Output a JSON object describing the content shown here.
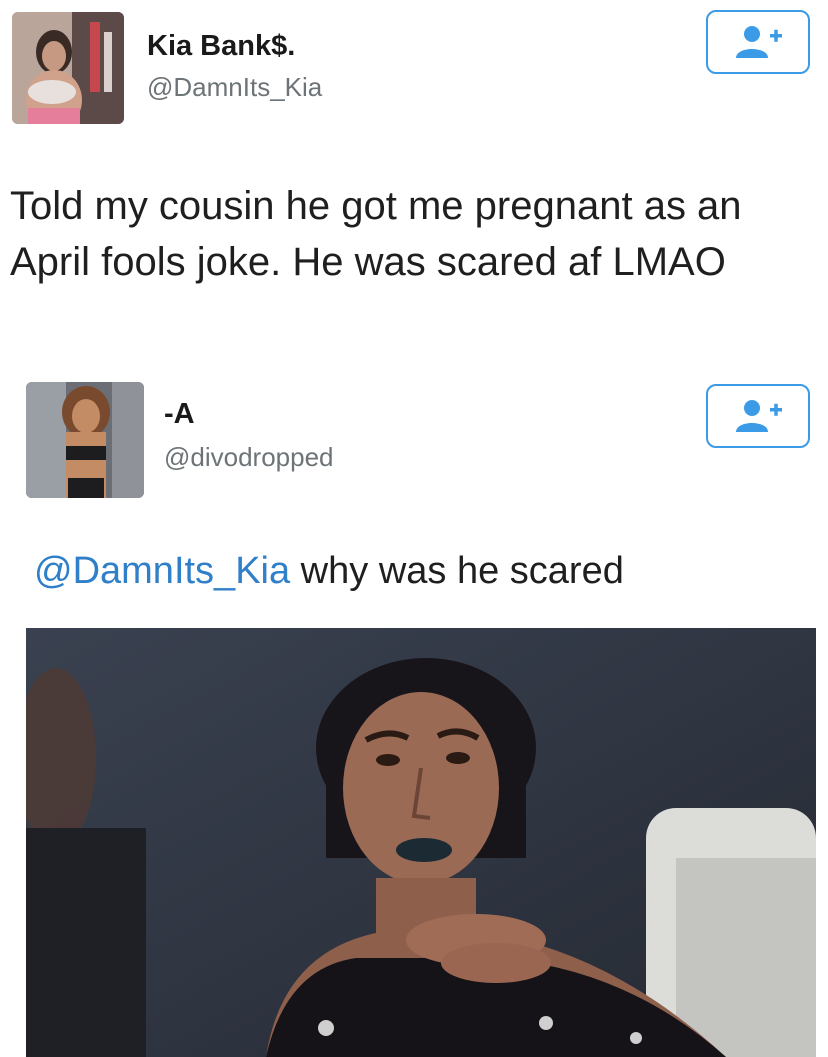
{
  "tweets": [
    {
      "display_name": "Kia Bank$.",
      "handle": "@DamnIts_Kia",
      "text": "Told my cousin he got me pregnant as an April fools joke. He was scared af LMAO",
      "follow_icon": "add-user-icon"
    },
    {
      "display_name": "-A",
      "handle": "@divodropped",
      "reply_mention": "@DamnIts_Kia",
      "reply_text": " why was he scared",
      "follow_icon": "add-user-icon",
      "media_description_icon": "photo"
    }
  ],
  "colors": {
    "accent": "#3b9be6",
    "mention": "#2f7fc9",
    "handle_gray": "#6d7478"
  }
}
